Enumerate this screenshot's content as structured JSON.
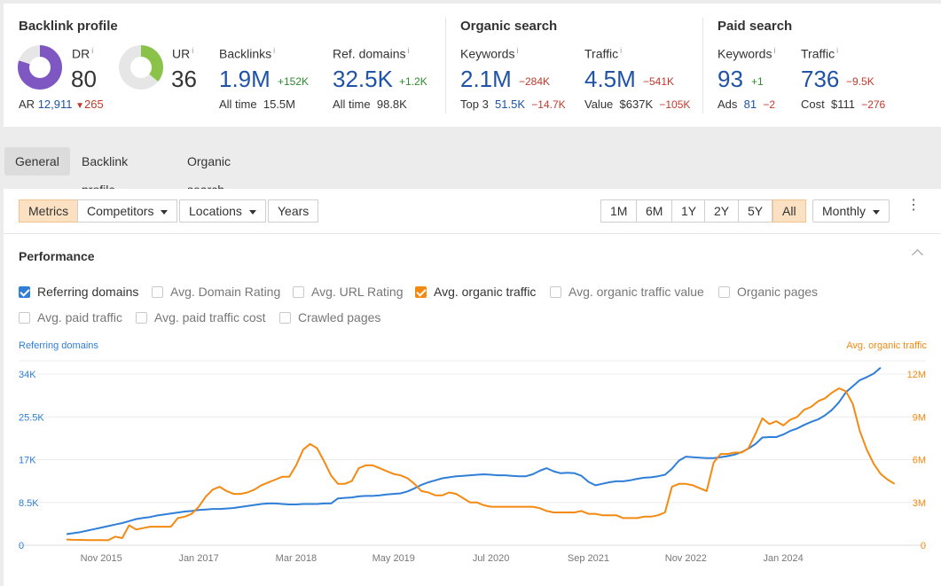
{
  "backlink_profile": {
    "title": "Backlink profile",
    "dr": {
      "label": "DR",
      "info": "i",
      "value": "80",
      "fill_pct": 80,
      "color": "#7e57c2"
    },
    "ur": {
      "label": "UR",
      "info": "i",
      "value": "36",
      "fill_pct": 36,
      "color": "#8bc34a"
    },
    "ar": {
      "label": "AR",
      "value": "12,911",
      "delta": "265",
      "delta_icon": "triangle-down-icon"
    },
    "backlinks": {
      "label": "Backlinks",
      "info": "i",
      "value": "1.9M",
      "delta": "+152K",
      "sub_label": "All time",
      "sub_value": "15.5M"
    },
    "ref_domains": {
      "label": "Ref. domains",
      "info": "i",
      "value": "32.5K",
      "delta": "+1.2K",
      "sub_label": "All time",
      "sub_value": "98.8K"
    }
  },
  "organic_search": {
    "title": "Organic search",
    "keywords": {
      "label": "Keywords",
      "info": "i",
      "value": "2.1M",
      "delta": "−284K",
      "sub_label": "Top 3",
      "sub_value": "51.5K",
      "sub_delta": "−14.7K"
    },
    "traffic": {
      "label": "Traffic",
      "info": "i",
      "value": "4.5M",
      "delta": "−541K",
      "sub_label": "Value",
      "sub_value": "$637K",
      "sub_delta": "−105K"
    }
  },
  "paid_search": {
    "title": "Paid search",
    "keywords": {
      "label": "Keywords",
      "info": "i",
      "value": "93",
      "delta": "+1",
      "sub_label": "Ads",
      "sub_value": "81",
      "sub_delta": "−2"
    },
    "traffic": {
      "label": "Traffic",
      "info": "i",
      "value": "736",
      "delta": "−9.5K",
      "sub_label": "Cost",
      "sub_value": "$111",
      "sub_delta": "−276"
    }
  },
  "tabs": [
    {
      "label": "General",
      "active": true
    },
    {
      "label": "Backlink profile",
      "active": false
    },
    {
      "label": "Organic search",
      "active": false
    }
  ],
  "toolbar": {
    "left": [
      {
        "label": "Metrics",
        "active": true,
        "dropdown": false
      },
      {
        "label": "Competitors",
        "active": false,
        "dropdown": true
      },
      {
        "label": "Locations",
        "active": false,
        "dropdown": true
      },
      {
        "label": "Years",
        "active": false,
        "dropdown": false
      }
    ],
    "ranges": [
      {
        "label": "1M",
        "active": false
      },
      {
        "label": "6M",
        "active": false
      },
      {
        "label": "1Y",
        "active": false
      },
      {
        "label": "2Y",
        "active": false
      },
      {
        "label": "5Y",
        "active": false
      },
      {
        "label": "All",
        "active": true
      }
    ],
    "interval": "Monthly"
  },
  "performance": {
    "title": "Performance",
    "checkboxes": [
      {
        "label": "Referring domains",
        "checked": true,
        "color": "#2f7ed8"
      },
      {
        "label": "Avg. Domain Rating",
        "checked": false
      },
      {
        "label": "Avg. URL Rating",
        "checked": false
      },
      {
        "label": "Avg. organic traffic",
        "checked": true,
        "color": "#f48a12"
      },
      {
        "label": "Avg. organic traffic value",
        "checked": false
      },
      {
        "label": "Organic pages",
        "checked": false
      },
      {
        "label": "Avg. paid traffic",
        "checked": false
      },
      {
        "label": "Avg. paid traffic cost",
        "checked": false
      },
      {
        "label": "Crawled pages",
        "checked": false
      }
    ]
  },
  "chart_data": {
    "type": "line",
    "title": "Performance",
    "xlabel": "",
    "x_start": "Jun 2015",
    "x_end": "Jan 2024",
    "x_ticks": [
      "Nov 2015",
      "Jan 2017",
      "Mar 2018",
      "May 2019",
      "Jul 2020",
      "Sep 2021",
      "Nov 2022",
      "Jan 2024"
    ],
    "grid": true,
    "legend": "none",
    "left_axis": {
      "label": "Referring domains",
      "color": "#2f7ed8",
      "ticks": [
        "0",
        "8.5K",
        "17K",
        "25.5K",
        "34K"
      ],
      "range": [
        0,
        34000
      ]
    },
    "right_axis": {
      "label": "Avg. organic traffic",
      "color": "#f48a12",
      "ticks": [
        "0",
        "3M",
        "6M",
        "9M",
        "12M"
      ],
      "range": [
        0,
        12000000
      ]
    },
    "series": [
      {
        "name": "Referring domains",
        "axis": "left",
        "color": "#2f7ed8",
        "values": [
          2200,
          2400,
          2600,
          2900,
          3200,
          3500,
          3800,
          4100,
          4400,
          4800,
          5200,
          5400,
          5600,
          5900,
          6100,
          6300,
          6500,
          6700,
          6800,
          7000,
          7100,
          7200,
          7200,
          7300,
          7400,
          7600,
          7800,
          8000,
          8200,
          8300,
          8300,
          8200,
          8100,
          8100,
          8200,
          8200,
          8200,
          8300,
          8300,
          9300,
          9400,
          9500,
          9700,
          9800,
          9800,
          9900,
          10100,
          10200,
          10300,
          10700,
          11300,
          12000,
          12500,
          12900,
          13300,
          13500,
          13700,
          13800,
          13900,
          14000,
          14100,
          14000,
          13900,
          13900,
          13800,
          13700,
          13700,
          14100,
          14800,
          15300,
          14700,
          14300,
          14400,
          14300,
          13800,
          12600,
          11900,
          12200,
          12500,
          12700,
          12700,
          12900,
          13200,
          13400,
          13500,
          13700,
          14000,
          15200,
          16800,
          17600,
          17500,
          17400,
          17300,
          17300,
          17500,
          17700,
          18000,
          18500,
          19200,
          20100,
          21400,
          21500,
          21500,
          22000,
          22700,
          23200,
          23900,
          24500,
          25000,
          25800,
          26900,
          28400,
          30400,
          31600,
          32800,
          33400,
          34100,
          35300
        ]
      },
      {
        "name": "Avg. organic traffic",
        "axis": "right",
        "color": "#f48a12",
        "values": [
          400000,
          380000,
          370000,
          360000,
          360000,
          360000,
          350000,
          600000,
          500000,
          1400000,
          1100000,
          1200000,
          1300000,
          1300000,
          1300000,
          1300000,
          1900000,
          2000000,
          2200000,
          2700000,
          3400000,
          3900000,
          4100000,
          3800000,
          3600000,
          3600000,
          3700000,
          3900000,
          4200000,
          4400000,
          4600000,
          4800000,
          4800000,
          5600000,
          6700000,
          7100000,
          6800000,
          5900000,
          4900000,
          4300000,
          4300000,
          4500000,
          5400000,
          5600000,
          5600000,
          5400000,
          5200000,
          5000000,
          4900000,
          4700000,
          4300000,
          3800000,
          3700000,
          3500000,
          3500000,
          3700000,
          3600000,
          3300000,
          3000000,
          3000000,
          2800000,
          2700000,
          2700000,
          2700000,
          2700000,
          2700000,
          2700000,
          2700000,
          2600000,
          2400000,
          2300000,
          2300000,
          2300000,
          2300000,
          2400000,
          2200000,
          2200000,
          2100000,
          2100000,
          2100000,
          1900000,
          1900000,
          1900000,
          2000000,
          2000000,
          2100000,
          2300000,
          4100000,
          4300000,
          4300000,
          4200000,
          4000000,
          3800000,
          5800000,
          6400000,
          6400000,
          6500000,
          6500000,
          6800000,
          7800000,
          8900000,
          8500000,
          8700000,
          8400000,
          8800000,
          9000000,
          9500000,
          9700000,
          10100000,
          10300000,
          10700000,
          11000000,
          10800000,
          9900000,
          8000000,
          6700000,
          5700000,
          5000000,
          4600000,
          4300000
        ]
      }
    ]
  }
}
